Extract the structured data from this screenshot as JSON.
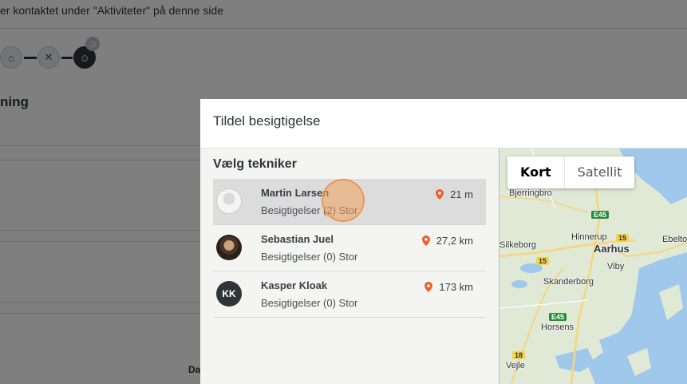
{
  "background": {
    "banner_text": "er kontaktet under \"Aktiviteter\" på denne side",
    "heading_fragment": "ning",
    "footer_fragment": "Da"
  },
  "modal": {
    "title": "Tildel besigtigelse",
    "section_title": "Vælg tekniker",
    "technicians": [
      {
        "name": "Martin Larsen",
        "subtitle": "Besigtigelser (2) Stor",
        "distance": "21 m",
        "avatar": "photo-light",
        "initials": "",
        "selected": true
      },
      {
        "name": "Sebastian Juel",
        "subtitle": "Besigtigelser (0) Stor",
        "distance": "27,2 km",
        "avatar": "photo-dark",
        "initials": "",
        "selected": false
      },
      {
        "name": "Kasper Kloak",
        "subtitle": "Besigtigelser (0) Stor",
        "distance": "173 km",
        "avatar": "initials",
        "initials": "KK",
        "selected": false
      }
    ],
    "map": {
      "tabs": [
        "Kort",
        "Satellit"
      ],
      "active_tab": "Kort",
      "labels": [
        "Bjerringbro",
        "Hinnerup",
        "Aarhus",
        "Ebelto",
        "Silkeborg",
        "Viby",
        "Skanderborg",
        "Horsens",
        "Vejle"
      ],
      "shields": [
        "E45",
        "15",
        "15",
        "E45",
        "18"
      ]
    }
  },
  "colors": {
    "pin": "#e8632a",
    "selected_row": "#dcdcdc",
    "water": "#9fc8ea",
    "land": "#dfe9d6"
  }
}
